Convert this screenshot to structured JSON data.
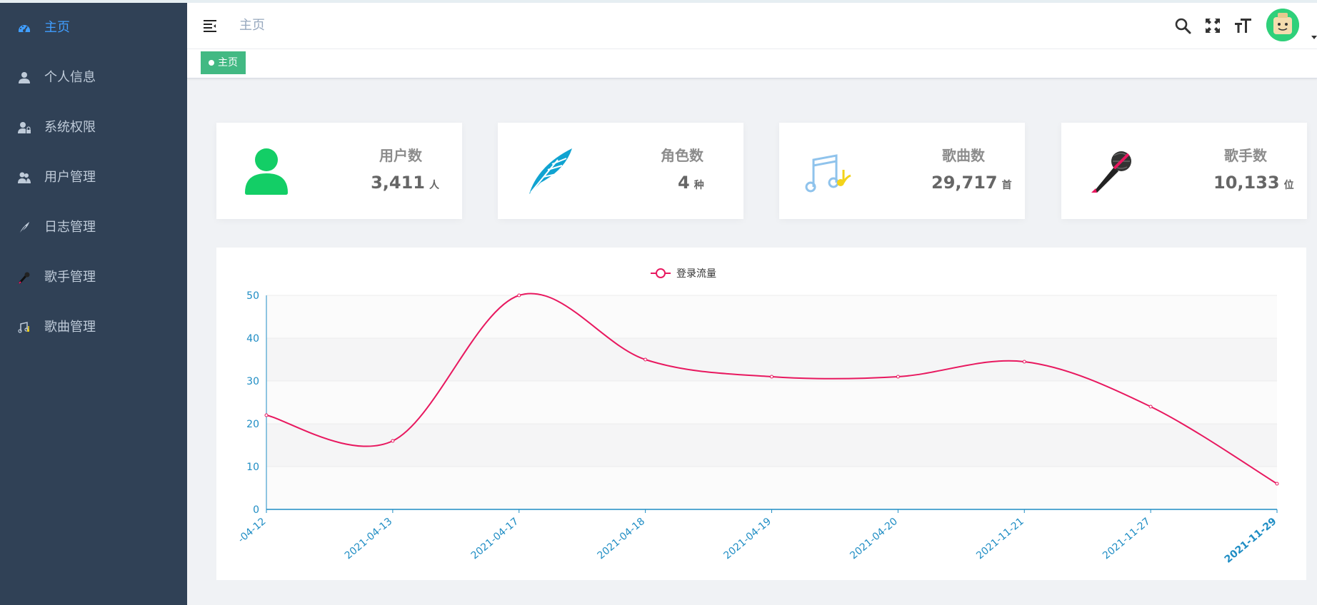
{
  "sidebar": {
    "items": [
      {
        "label": "主页",
        "icon": "dashboard-icon",
        "active": true
      },
      {
        "label": "个人信息",
        "icon": "user-icon",
        "active": false
      },
      {
        "label": "系统权限",
        "icon": "user-lock-icon",
        "active": false
      },
      {
        "label": "用户管理",
        "icon": "users-icon",
        "active": false
      },
      {
        "label": "日志管理",
        "icon": "feather-icon",
        "active": false
      },
      {
        "label": "歌手管理",
        "icon": "microphone-icon",
        "active": false
      },
      {
        "label": "歌曲管理",
        "icon": "music-note-icon",
        "active": false
      }
    ]
  },
  "header": {
    "breadcrumb": "主页"
  },
  "tags": {
    "active_tag": "主页"
  },
  "cards": [
    {
      "title": "用户数",
      "value": "3,411",
      "unit": "人",
      "icon": "user-icon",
      "color": "#13ce66"
    },
    {
      "title": "角色数",
      "value": "4",
      "unit": "种",
      "icon": "feather-icon",
      "color": "#10a3d1"
    },
    {
      "title": "歌曲数",
      "value": "29,717",
      "unit": "首",
      "icon": "music-note-icon",
      "color": "#f3d31a"
    },
    {
      "title": "歌手数",
      "value": "10,133",
      "unit": "位",
      "icon": "microphone-icon",
      "color": "#222222"
    }
  ],
  "colors": {
    "sidebar_bg": "#304156",
    "sidebar_text": "#bfcbd9",
    "active": "#409eff",
    "tag": "#42b983",
    "line": "#e8185f",
    "axis": "#1f8dc4"
  },
  "chart_data": {
    "type": "line",
    "legend": "登录流量",
    "x": [
      "-04-12",
      "2021-04-13",
      "2021-04-17",
      "2021-04-18",
      "2021-04-19",
      "2021-04-20",
      "2021-11-21",
      "2021-11-27",
      "2021-11-29"
    ],
    "series": [
      {
        "name": "登录流量",
        "values": [
          22,
          16,
          50,
          35,
          31,
          31,
          34.5,
          24,
          6
        ]
      }
    ],
    "ylim": [
      0,
      50
    ],
    "yticks": [
      0,
      10,
      20,
      30,
      40,
      50
    ],
    "smooth": true,
    "grid": "horizontal bands",
    "legend_position": "top-center"
  }
}
